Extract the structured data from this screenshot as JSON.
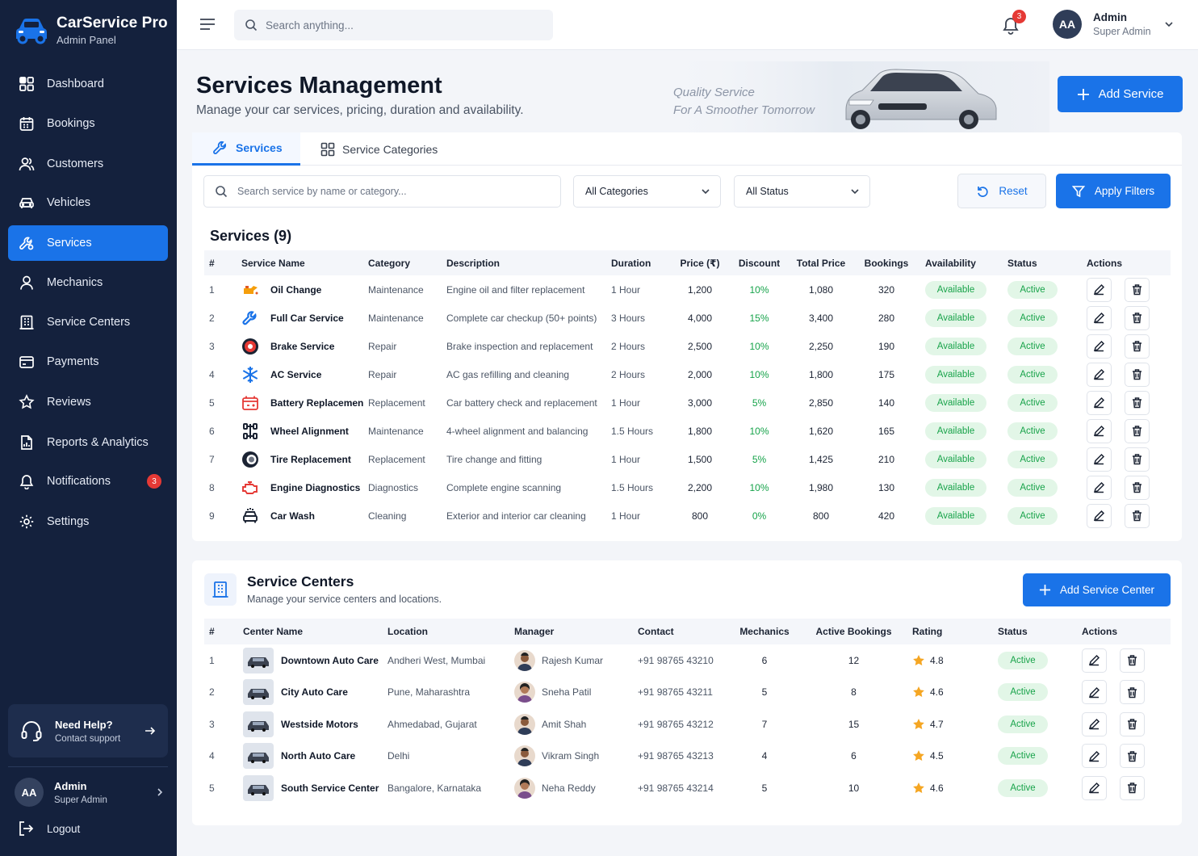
{
  "brand": {
    "title": "CarService Pro",
    "subtitle": "Admin Panel"
  },
  "sidebar": {
    "items": [
      {
        "label": "Dashboard",
        "icon": "grid-icon"
      },
      {
        "label": "Bookings",
        "icon": "calendar-icon"
      },
      {
        "label": "Customers",
        "icon": "users-icon"
      },
      {
        "label": "Vehicles",
        "icon": "car-icon"
      },
      {
        "label": "Services",
        "icon": "tools-icon",
        "active": true
      },
      {
        "label": "Mechanics",
        "icon": "user-icon"
      },
      {
        "label": "Service Centers",
        "icon": "building-icon"
      },
      {
        "label": "Payments",
        "icon": "wallet-icon"
      },
      {
        "label": "Reviews",
        "icon": "star-icon"
      },
      {
        "label": "Reports & Analytics",
        "icon": "report-icon"
      },
      {
        "label": "Notifications",
        "icon": "bell-icon",
        "badge": "3"
      },
      {
        "label": "Settings",
        "icon": "gear-icon"
      }
    ],
    "help": {
      "title": "Need Help?",
      "subtitle": "Contact support"
    },
    "user": {
      "initials": "AA",
      "name": "Admin",
      "role": "Super Admin"
    },
    "logout": "Logout"
  },
  "topbar": {
    "search_placeholder": "Search anything...",
    "notification_count": "3",
    "user": {
      "initials": "AA",
      "name": "Admin",
      "role": "Super Admin"
    }
  },
  "header": {
    "title": "Services Management",
    "subtitle": "Manage your car services, pricing, duration and availability.",
    "quote_line1": "Quality Service",
    "quote_line2": "For A Smoother Tomorrow",
    "add_button": "Add Service"
  },
  "tabs": [
    {
      "label": "Services",
      "active": true
    },
    {
      "label": "Service Categories",
      "active": false
    }
  ],
  "filters": {
    "search_placeholder": "Search service by name or category...",
    "category": "All Categories",
    "status": "All Status",
    "reset": "Reset",
    "apply": "Apply Filters"
  },
  "services": {
    "title": "Services (9)",
    "columns": [
      "#",
      "Service Name",
      "Category",
      "Description",
      "Duration",
      "Price (₹)",
      "Discount",
      "Total Price",
      "Bookings",
      "Availability",
      "Status",
      "Actions"
    ],
    "rows": [
      {
        "n": "1",
        "name": "Oil Change",
        "icon": "oil-can-icon",
        "category": "Maintenance",
        "description": "Engine oil and filter replacement",
        "duration": "1 Hour",
        "price": "1,200",
        "discount": "10%",
        "total": "1,080",
        "bookings": "320",
        "availability": "Available",
        "status": "Active"
      },
      {
        "n": "2",
        "name": "Full Car Service",
        "icon": "wrench-icon",
        "category": "Maintenance",
        "description": "Complete car checkup (50+ points)",
        "duration": "3 Hours",
        "price": "4,000",
        "discount": "15%",
        "total": "3,400",
        "bookings": "280",
        "availability": "Available",
        "status": "Active"
      },
      {
        "n": "3",
        "name": "Brake Service",
        "icon": "brake-disc-icon",
        "category": "Repair",
        "description": "Brake inspection and replacement",
        "duration": "2 Hours",
        "price": "2,500",
        "discount": "10%",
        "total": "2,250",
        "bookings": "190",
        "availability": "Available",
        "status": "Active"
      },
      {
        "n": "4",
        "name": "AC Service",
        "icon": "snowflake-icon",
        "category": "Repair",
        "description": "AC gas refilling and cleaning",
        "duration": "2 Hours",
        "price": "2,000",
        "discount": "10%",
        "total": "1,800",
        "bookings": "175",
        "availability": "Available",
        "status": "Active"
      },
      {
        "n": "5",
        "name": "Battery Replacement",
        "icon": "battery-icon",
        "category": "Replacement",
        "description": "Car battery check and replacement",
        "duration": "1 Hour",
        "price": "3,000",
        "discount": "5%",
        "total": "2,850",
        "bookings": "140",
        "availability": "Available",
        "status": "Active"
      },
      {
        "n": "6",
        "name": "Wheel Alignment",
        "icon": "alignment-icon",
        "category": "Maintenance",
        "description": "4-wheel alignment and balancing",
        "duration": "1.5 Hours",
        "price": "1,800",
        "discount": "10%",
        "total": "1,620",
        "bookings": "165",
        "availability": "Available",
        "status": "Active"
      },
      {
        "n": "7",
        "name": "Tire Replacement",
        "icon": "tire-icon",
        "category": "Replacement",
        "description": "Tire change and fitting",
        "duration": "1 Hour",
        "price": "1,500",
        "discount": "5%",
        "total": "1,425",
        "bookings": "210",
        "availability": "Available",
        "status": "Active"
      },
      {
        "n": "8",
        "name": "Engine Diagnostics",
        "icon": "engine-icon",
        "category": "Diagnostics",
        "description": "Complete engine scanning",
        "duration": "1.5 Hours",
        "price": "2,200",
        "discount": "10%",
        "total": "1,980",
        "bookings": "130",
        "availability": "Available",
        "status": "Active"
      },
      {
        "n": "9",
        "name": "Car Wash",
        "icon": "car-wash-icon",
        "category": "Cleaning",
        "description": "Exterior and interior car cleaning",
        "duration": "1 Hour",
        "price": "800",
        "discount": "0%",
        "total": "800",
        "bookings": "420",
        "availability": "Available",
        "status": "Active"
      }
    ]
  },
  "centers": {
    "title": "Service Centers",
    "subtitle": "Manage your service centers and locations.",
    "add_button": "Add Service Center",
    "columns": [
      "#",
      "Center Name",
      "Location",
      "Manager",
      "Contact",
      "Mechanics",
      "Active Bookings",
      "Rating",
      "Status",
      "Actions"
    ],
    "rows": [
      {
        "n": "1",
        "name": "Downtown Auto Care",
        "location": "Andheri West, Mumbai",
        "manager": "Rajesh Kumar",
        "contact": "+91 98765 43210",
        "mechanics": "6",
        "bookings": "12",
        "rating": "4.8",
        "status": "Active"
      },
      {
        "n": "2",
        "name": "City Auto Care",
        "location": "Pune, Maharashtra",
        "manager": "Sneha Patil",
        "contact": "+91 98765 43211",
        "mechanics": "5",
        "bookings": "8",
        "rating": "4.6",
        "status": "Active"
      },
      {
        "n": "3",
        "name": "Westside Motors",
        "location": "Ahmedabad, Gujarat",
        "manager": "Amit Shah",
        "contact": "+91 98765 43212",
        "mechanics": "7",
        "bookings": "15",
        "rating": "4.7",
        "status": "Active"
      },
      {
        "n": "4",
        "name": "North Auto Care",
        "location": "Delhi",
        "manager": "Vikram Singh",
        "contact": "+91 98765 43213",
        "mechanics": "4",
        "bookings": "6",
        "rating": "4.5",
        "status": "Active"
      },
      {
        "n": "5",
        "name": "South Service Center",
        "location": "Bangalore, Karnataka",
        "manager": "Neha Reddy",
        "contact": "+91 98765 43214",
        "mechanics": "5",
        "bookings": "10",
        "rating": "4.6",
        "status": "Active"
      }
    ]
  },
  "colors": {
    "primary": "#1a73e8",
    "sidebar": "#14213d",
    "success_bg": "#e2f6e7",
    "success": "#18a34a",
    "danger": "#e53935",
    "star": "#f5a623"
  }
}
